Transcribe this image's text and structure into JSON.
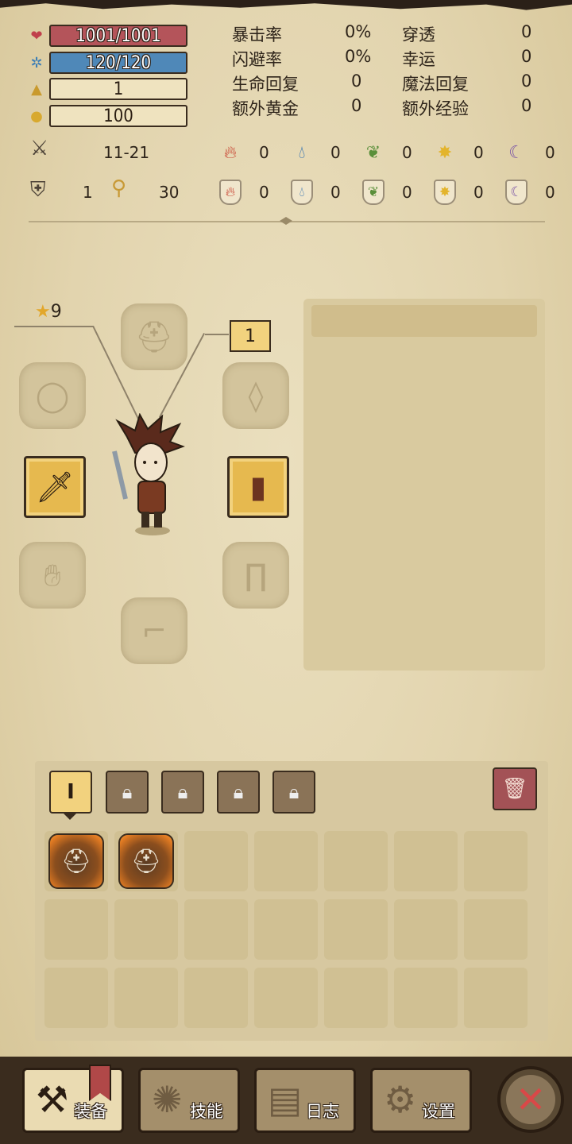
{
  "stats": {
    "hp": "1001/1001",
    "mp": "120/120",
    "level": "1",
    "gold": "100"
  },
  "secondary": [
    {
      "label": "暴击率",
      "value": "0%",
      "label2": "穿透",
      "value2": "0"
    },
    {
      "label": "闪避率",
      "value": "0%",
      "label2": "幸运",
      "value2": "0"
    },
    {
      "label": "生命回复",
      "value": "0",
      "label2": "魔法回复",
      "value2": "0"
    },
    {
      "label": "额外黄金",
      "value": "0",
      "label2": "额外经验",
      "value2": "0"
    }
  ],
  "attack": {
    "damage": "11-21",
    "elements": [
      "0",
      "0",
      "0",
      "0",
      "0"
    ]
  },
  "defense": {
    "armor": "1",
    "power": "30",
    "elements": [
      "0",
      "0",
      "0",
      "0",
      "0"
    ]
  },
  "equipment": {
    "star_level": "9",
    "item_level": "1"
  },
  "inventory": {
    "active_tab": "I"
  },
  "nav": {
    "equip": "装备",
    "skills": "技能",
    "journal": "日志",
    "settings": "设置"
  },
  "icons": {
    "hp": "heart-icon",
    "mp": "snowflake-icon",
    "level": "triangle-icon",
    "gold": "gold-icon",
    "close": "close-icon"
  },
  "colors": {
    "hp": "#b4545a",
    "mp": "#4f88b8",
    "gold_frame": "#f2d27e",
    "close": "#d94848"
  }
}
